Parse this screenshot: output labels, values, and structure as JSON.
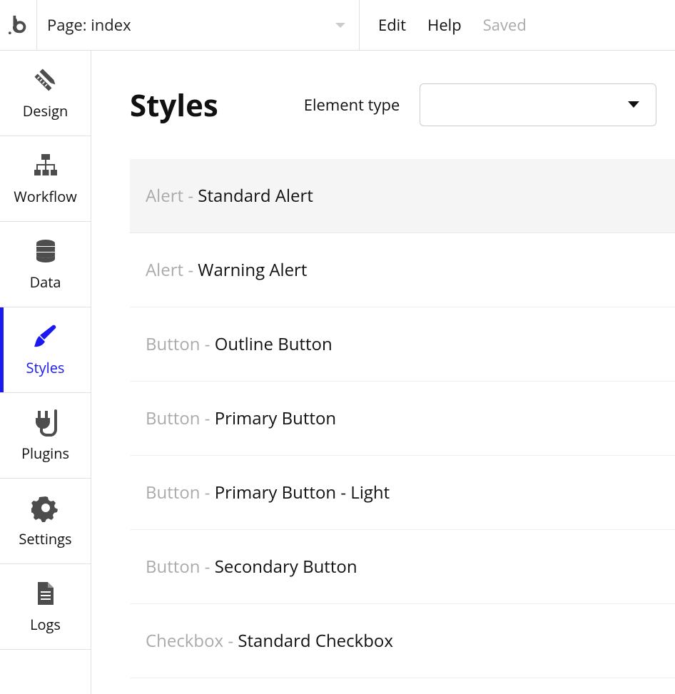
{
  "topbar": {
    "page_label": "Page: index",
    "menu": [
      "Edit",
      "Help",
      "Saved"
    ]
  },
  "sidebar": {
    "items": [
      {
        "id": "design",
        "label": "Design",
        "icon": "design"
      },
      {
        "id": "workflow",
        "label": "Workflow",
        "icon": "workflow"
      },
      {
        "id": "data",
        "label": "Data",
        "icon": "data"
      },
      {
        "id": "styles",
        "label": "Styles",
        "icon": "styles",
        "active": true
      },
      {
        "id": "plugins",
        "label": "Plugins",
        "icon": "plugins"
      },
      {
        "id": "settings",
        "label": "Settings",
        "icon": "settings"
      },
      {
        "id": "logs",
        "label": "Logs",
        "icon": "logs"
      }
    ]
  },
  "main": {
    "title": "Styles",
    "filter_label": "Element type",
    "rows": [
      {
        "category": "Alert",
        "name": "Standard Alert",
        "selected": true
      },
      {
        "category": "Alert",
        "name": "Warning Alert"
      },
      {
        "category": "Button",
        "name": "Outline Button"
      },
      {
        "category": "Button",
        "name": "Primary Button"
      },
      {
        "category": "Button",
        "name": "Primary Button - Light"
      },
      {
        "category": "Button",
        "name": "Secondary Button"
      },
      {
        "category": "Checkbox",
        "name": "Standard Checkbox"
      }
    ]
  }
}
